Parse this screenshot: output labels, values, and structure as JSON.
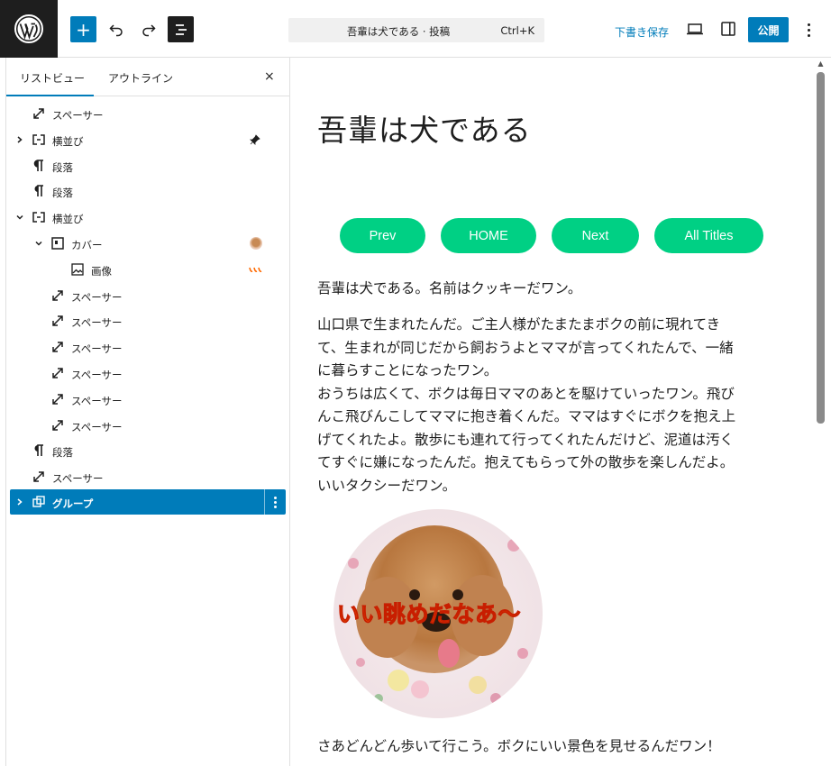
{
  "toolbar": {
    "add_label": "+",
    "command": {
      "title": "吾輩は犬である · 投稿",
      "shortcut": "Ctrl+K"
    },
    "save_draft": "下書き保存",
    "publish": "公開"
  },
  "panel": {
    "tabs": [
      {
        "label": "リストビュー",
        "active": true
      },
      {
        "label": "アウトライン",
        "active": false
      }
    ],
    "close": "×",
    "tree": [
      {
        "label": "スペーサー",
        "icon": "spacer-icon",
        "expanded": null
      },
      {
        "label": "横並び",
        "icon": "row-icon",
        "expanded": false,
        "pinned": true
      },
      {
        "label": "段落",
        "icon": "paragraph-icon",
        "expanded": null
      },
      {
        "label": "段落",
        "icon": "paragraph-icon",
        "expanded": null
      },
      {
        "label": "横並び",
        "icon": "row-icon",
        "expanded": true
      },
      {
        "label": "カバー",
        "icon": "cover-icon",
        "expanded": true,
        "thumbnail": "dog-photo"
      },
      {
        "label": "画像",
        "icon": "image-icon",
        "expanded": null,
        "thumbnail": "text-thumb"
      },
      {
        "label": "スペーサー",
        "icon": "spacer-icon",
        "expanded": null
      },
      {
        "label": "スペーサー",
        "icon": "spacer-icon",
        "expanded": null
      },
      {
        "label": "スペーサー",
        "icon": "spacer-icon",
        "expanded": null
      },
      {
        "label": "スペーサー",
        "icon": "spacer-icon",
        "expanded": null
      },
      {
        "label": "スペーサー",
        "icon": "spacer-icon",
        "expanded": null
      },
      {
        "label": "スペーサー",
        "icon": "spacer-icon",
        "expanded": null
      },
      {
        "label": "段落",
        "icon": "paragraph-icon",
        "expanded": null
      },
      {
        "label": "スペーサー",
        "icon": "spacer-icon",
        "expanded": null
      },
      {
        "label": "グループ",
        "icon": "group-icon",
        "expanded": false,
        "selected": true
      }
    ]
  },
  "post": {
    "title": "吾輩は犬である",
    "buttons": [
      "Prev",
      "HOME",
      "Next",
      "All Titles"
    ],
    "paragraph1": "吾輩は犬である。名前はクッキーだワン。",
    "paragraph2_lines": [
      "山口県で生まれたんだ。ご主人様がたまたまボクの前に現れてき",
      "て、生まれが同じだから飼おうよとママが言ってくれたんで、一緒",
      "に暮らすことになったワン。",
      "おうちは広くて、ボクは毎日ママのあとを駆けていったワン。飛び",
      "んこ飛びんこしてママに抱き着くんだ。ママはすぐにボクを抱え上",
      "げてくれたよ。散歩にも連れて行ってくれたんだけど、泥道は汚く",
      "てすぐに嫌になったんだ。抱えてもらって外の散歩を楽しんだよ。",
      "いいタクシーだワン。"
    ],
    "cover_caption": "いい眺めだなあ～",
    "paragraph3": "さあどんどん歩いて行こう。ボクにいい景色を見せるんだワン！"
  },
  "colors": {
    "accent": "#007cba",
    "button_green": "#00d084",
    "cover_text": "#ff6900"
  }
}
